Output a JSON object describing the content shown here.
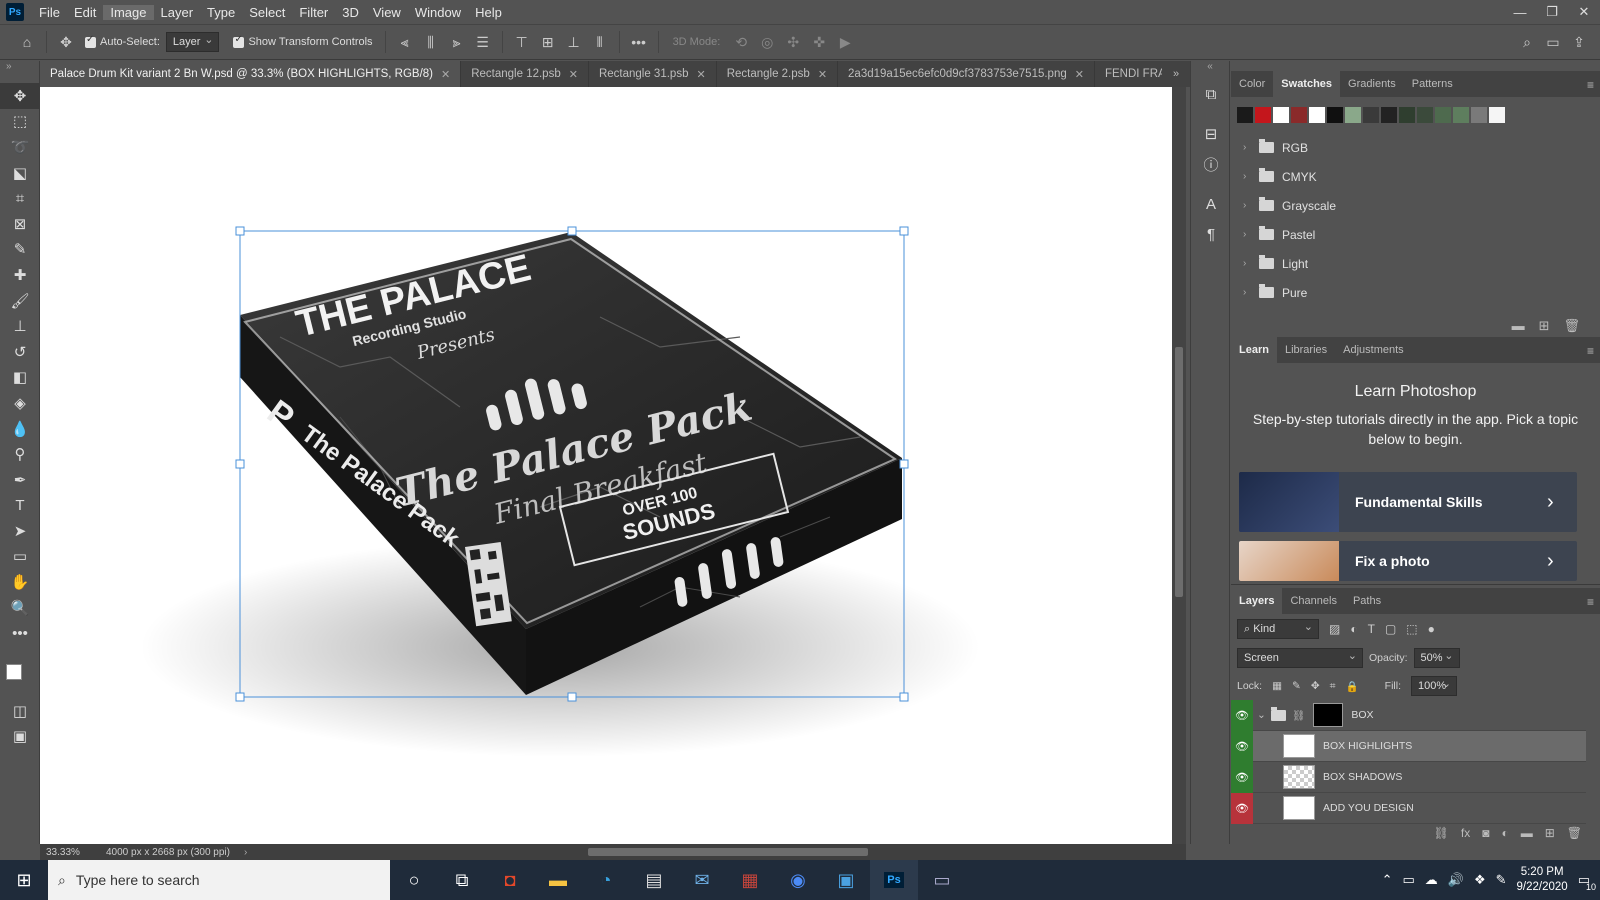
{
  "app": {
    "logo": "Ps",
    "menu": [
      "File",
      "Edit",
      "Image",
      "Layer",
      "Type",
      "Select",
      "Filter",
      "3D",
      "View",
      "Window",
      "Help"
    ],
    "active_menu": "Image"
  },
  "options_bar": {
    "auto_select_label": "Auto-Select:",
    "auto_select_target": "Layer",
    "show_transform_label": "Show Transform Controls",
    "mode_3d_label": "3D Mode:"
  },
  "tabs": [
    {
      "label": "Palace Drum Kit variant 2 Bn W.psd @ 33.3% (BOX HIGHLIGHTS, RGB/8)",
      "active": true
    },
    {
      "label": "Rectangle 12.psb"
    },
    {
      "label": "Rectangle 31.psb"
    },
    {
      "label": "Rectangle 2.psb"
    },
    {
      "label": "2a3d19a15ec6efc0d9cf3783753e7515.png"
    },
    {
      "label": "FENDI FRAMI"
    }
  ],
  "canvas": {
    "box_texts": {
      "title": "THE PALACE",
      "subtitle": "Recording Studio",
      "presents": "Presents",
      "pack": "The Palace Pack",
      "script": "Final Breakfast",
      "badge_line1": "OVER 100",
      "badge_line2": "SOUNDS",
      "side_letter": "P",
      "side_text": "The Palace Pack"
    }
  },
  "status": {
    "zoom": "33.33%",
    "doc_info": "4000 px x 2668 px (300 ppi)"
  },
  "swatches_panel": {
    "tabs": [
      "Color",
      "Swatches",
      "Gradients",
      "Patterns"
    ],
    "active_tab": "Swatches",
    "colors": [
      "#1a1a1a",
      "#c4161c",
      "#ffffff",
      "#8a2a2a",
      "#ffffff",
      "#101010",
      "#8aa88a",
      "#3a3a3a",
      "#222222",
      "#2f3e2f",
      "#3b4a3b",
      "#4e6a4e",
      "#5e7e5e",
      "#7a7a7a",
      "#f5f5f5"
    ],
    "groups": [
      "RGB",
      "CMYK",
      "Grayscale",
      "Pastel",
      "Light",
      "Pure"
    ]
  },
  "learn_panel": {
    "tabs": [
      "Learn",
      "Libraries",
      "Adjustments"
    ],
    "active_tab": "Learn",
    "heading": "Learn Photoshop",
    "description": "Step-by-step tutorials directly in the app. Pick a topic below to begin.",
    "cards": [
      "Fundamental Skills",
      "Fix a photo"
    ]
  },
  "layers_panel": {
    "tabs": [
      "Layers",
      "Channels",
      "Paths"
    ],
    "active_tab": "Layers",
    "filter_kind": "Kind",
    "blend_mode": "Screen",
    "opacity_label": "Opacity:",
    "opacity": "50%",
    "lock_label": "Lock:",
    "fill_label": "Fill:",
    "fill": "100%",
    "layers": [
      {
        "name": "BOX",
        "type": "group",
        "visible_color": "#2f7d2f"
      },
      {
        "name": "BOX HIGHLIGHTS",
        "selected": true,
        "visible_color": "#2f7d2f"
      },
      {
        "name": "BOX SHADOWS",
        "visible_color": "#2f7d2f"
      },
      {
        "name": "ADD YOU DESIGN",
        "visible_color": "#b7333b"
      }
    ]
  },
  "taskbar": {
    "search_placeholder": "Type here to search",
    "time": "5:20 PM",
    "date": "9/22/2020",
    "notification_count": "10"
  }
}
